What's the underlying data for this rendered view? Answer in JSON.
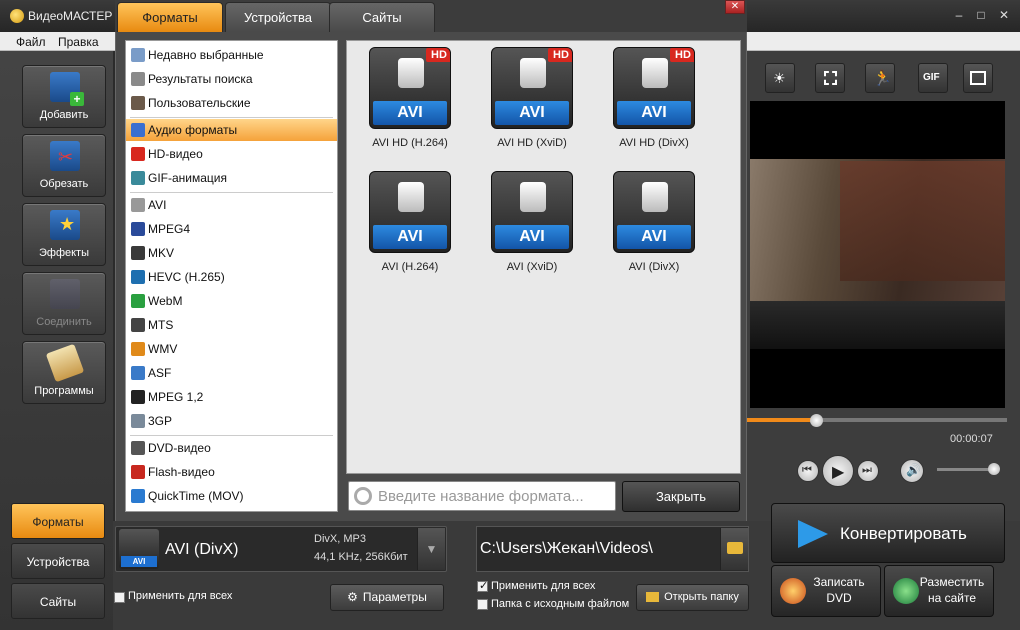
{
  "app": {
    "title": "ВидеоМАСТЕР",
    "window_controls": [
      "–",
      "□",
      "✕"
    ]
  },
  "menu": [
    "Файл",
    "Правка"
  ],
  "tools": [
    {
      "label": "Добавить",
      "icon": "add-video-icon"
    },
    {
      "label": "Обрезать",
      "icon": "cut-icon"
    },
    {
      "label": "Эффекты",
      "icon": "effects-icon"
    },
    {
      "label": "Соединить",
      "icon": "join-icon",
      "disabled": true
    },
    {
      "label": "Программы",
      "icon": "programs-icon"
    }
  ],
  "bottom_tabs": [
    {
      "label": "Форматы",
      "active": true
    },
    {
      "label": "Устройства"
    },
    {
      "label": "Сайты"
    }
  ],
  "dialog": {
    "tabs": [
      {
        "label": "Форматы",
        "active": true
      },
      {
        "label": "Устройства"
      },
      {
        "label": "Сайты"
      }
    ],
    "close_glyph": "✕",
    "categories": [
      {
        "label": "Недавно выбранные",
        "icon": "recent-icon",
        "color": "#7a9cc8"
      },
      {
        "label": "Результаты поиска",
        "icon": "search-results-icon",
        "color": "#8a8a8a"
      },
      {
        "label": "Пользовательские",
        "icon": "user-icon",
        "color": "#6b5a4a"
      },
      {
        "label": "Аудио форматы",
        "icon": "audio-icon",
        "color": "#3a6fd0",
        "selected": true
      },
      {
        "label": "HD-видео",
        "icon": "hd-icon",
        "color": "#d8281f"
      },
      {
        "label": "GIF-анимация",
        "icon": "gif-icon",
        "color": "#3a8a9a"
      },
      {
        "label": "AVI",
        "icon": "avi-icon",
        "color": "#999999"
      },
      {
        "label": "MPEG4",
        "icon": "mpeg4-icon",
        "color": "#2a4a9a"
      },
      {
        "label": "MKV",
        "icon": "mkv-icon",
        "color": "#3a3a3a"
      },
      {
        "label": "HEVC (H.265)",
        "icon": "hevc-icon",
        "color": "#1e6fb0"
      },
      {
        "label": "WebM",
        "icon": "webm-icon",
        "color": "#2aa040"
      },
      {
        "label": "MTS",
        "icon": "mts-icon",
        "color": "#444444"
      },
      {
        "label": "WMV",
        "icon": "wmv-icon",
        "color": "#e08a1a"
      },
      {
        "label": "ASF",
        "icon": "asf-icon",
        "color": "#3a7ac8"
      },
      {
        "label": "MPEG 1,2",
        "icon": "mpeg12-icon",
        "color": "#222222"
      },
      {
        "label": "3GP",
        "icon": "3gp-icon",
        "color": "#7a8a9a"
      },
      {
        "label": "DVD-видео",
        "icon": "dvd-icon",
        "color": "#555555"
      },
      {
        "label": "Flash-видео",
        "icon": "flash-icon",
        "color": "#c8281f"
      },
      {
        "label": "QuickTime (MOV)",
        "icon": "quicktime-icon",
        "color": "#2a7ad0"
      }
    ],
    "formats": [
      {
        "name": "AVI HD (H.264)",
        "badge": "AVI",
        "hd": "HD"
      },
      {
        "name": "AVI HD (XviD)",
        "badge": "AVI",
        "hd": "HD"
      },
      {
        "name": "AVI HD (DivX)",
        "badge": "AVI",
        "hd": "HD"
      },
      {
        "name": "AVI (H.264)",
        "badge": "AVI"
      },
      {
        "name": "AVI (XviD)",
        "badge": "AVI"
      },
      {
        "name": "AVI (DivX)",
        "badge": "AVI"
      }
    ],
    "search_placeholder": "Введите название формата...",
    "close_label": "Закрыть"
  },
  "output": {
    "format": "AVI (DivX)",
    "format_badge": "AVI",
    "codec_line1": "DivX, MP3",
    "codec_line2": "44,1 KHz, 256Кбит",
    "apply_all": "Применить для всех",
    "params_label": "Параметры",
    "path": "C:\\Users\\Жекан\\Videos\\",
    "apply_all_checked": true,
    "apply_all2": "Применить для всех",
    "source_folder": "Папка с исходным файлом",
    "open_folder": "Открыть папку"
  },
  "player": {
    "time": "00:00:07",
    "progress": 0.27,
    "volume": 0.95
  },
  "actions": {
    "convert": "Конвертировать",
    "burn_dvd": "Записать DVD",
    "upload": "Разместить на сайте"
  },
  "colors": {
    "accent": "#f08a1a",
    "active_tab": "#ffc45a"
  }
}
